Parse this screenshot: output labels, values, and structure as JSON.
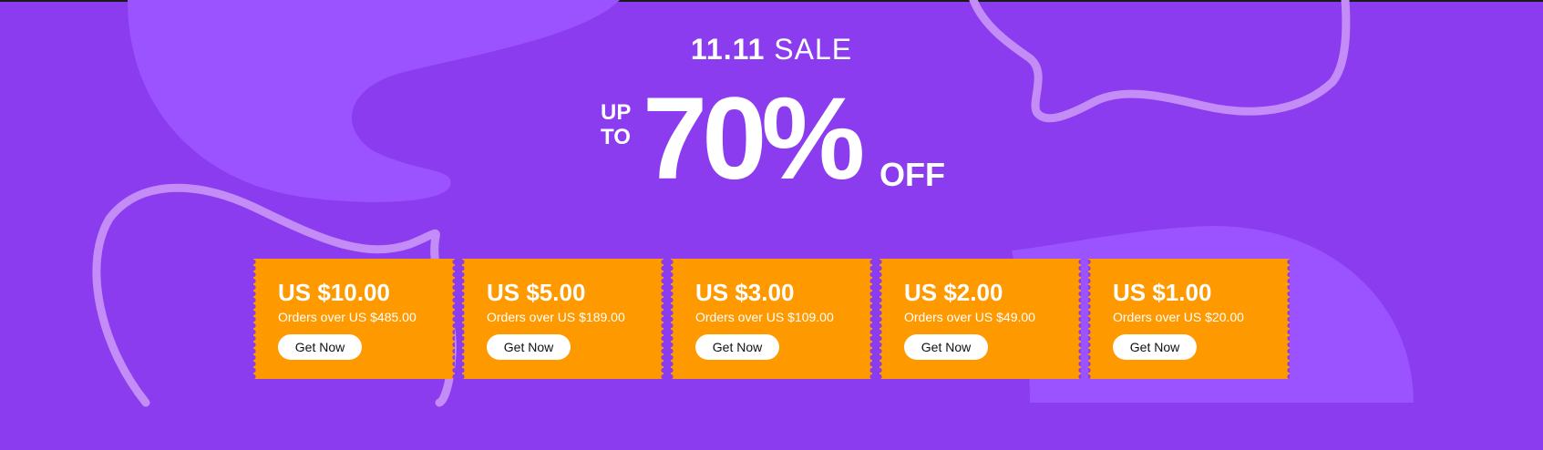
{
  "banner": {
    "sale_number": "11.11",
    "sale_word": "SALE",
    "up": "UP",
    "to": "TO",
    "percent": "70%",
    "off": "OFF",
    "colors": {
      "background": "#8a3cee",
      "blob": "#9b52ff",
      "stroke": "#c38cf7",
      "coupon": "#ff9900",
      "button": "#ffffff"
    }
  },
  "coupons": [
    {
      "amount": "US $10.00",
      "condition": "Orders over US $485.00",
      "button": "Get Now"
    },
    {
      "amount": "US $5.00",
      "condition": "Orders over US $189.00",
      "button": "Get Now"
    },
    {
      "amount": "US $3.00",
      "condition": "Orders over US $109.00",
      "button": "Get Now"
    },
    {
      "amount": "US $2.00",
      "condition": "Orders over US $49.00",
      "button": "Get Now"
    },
    {
      "amount": "US $1.00",
      "condition": "Orders over US $20.00",
      "button": "Get Now"
    }
  ]
}
